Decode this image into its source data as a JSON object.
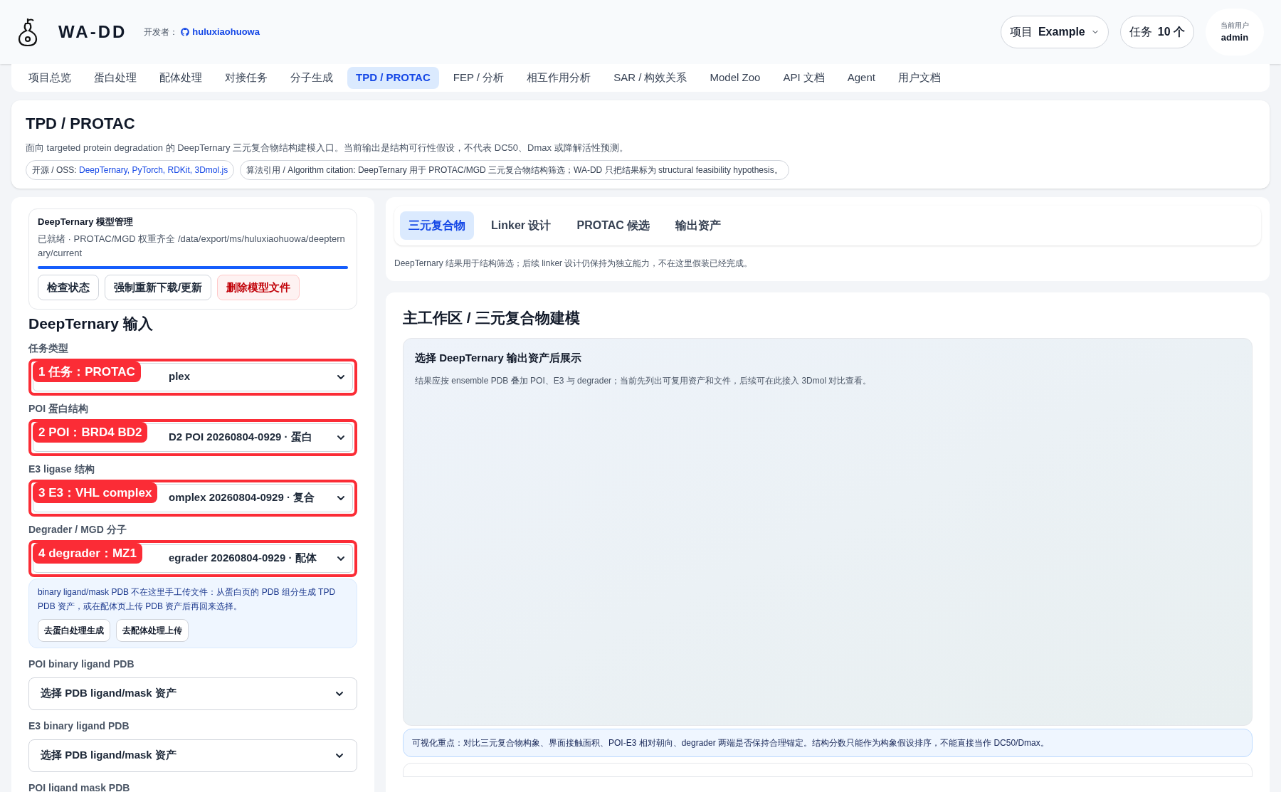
{
  "header": {
    "logo": "WA-DD",
    "developer_label": "开发者：",
    "developer": "huluxiaohuowa",
    "project_label": "项目",
    "project": "Example",
    "tasks_label": "任务",
    "tasks": "10 个",
    "user_label": "当前用户",
    "user": "admin"
  },
  "nav": [
    {
      "label": "项目总览",
      "selected": false
    },
    {
      "label": "蛋白处理",
      "selected": false
    },
    {
      "label": "配体处理",
      "selected": false
    },
    {
      "label": "对接任务",
      "selected": false
    },
    {
      "label": "分子生成",
      "selected": false
    },
    {
      "label": "TPD / PROTAC",
      "selected": true
    },
    {
      "label": "FEP / 分析",
      "selected": false
    },
    {
      "label": "相互作用分析",
      "selected": false
    },
    {
      "label": "SAR / 构效关系",
      "selected": false
    },
    {
      "label": "Model Zoo",
      "selected": false
    },
    {
      "label": "API 文档",
      "selected": false
    },
    {
      "label": "Agent",
      "selected": false
    },
    {
      "label": "用户文档",
      "selected": false
    }
  ],
  "page": {
    "title": "TPD / PROTAC",
    "subtitle": "面向 targeted protein degradation 的 DeepTernary 三元复合物结构建模入口。当前输出是结构可行性假设，不代表 DC50、Dmax 或降解活性预测。",
    "oss_label": "开源 / OSS:",
    "oss_links": "DeepTernary, PyTorch, RDKit, 3Dmol.js",
    "citation": "算法引用 / Algorithm citation: DeepTernary 用于 PROTAC/MGD 三元复合物结构筛选；WA-DD 只把结果标为 structural feasibility hypothesis。"
  },
  "model": {
    "title": "DeepTernary 模型管理",
    "status": "已就绪 · PROTAC/MGD 权重齐全 /data/export/ms/huluxiaohuowa/deepternary/current",
    "level": 1,
    "buttons": [
      {
        "label": "检查状态",
        "kind": "normal"
      },
      {
        "label": "强制重新下载/更新",
        "kind": "normal"
      },
      {
        "label": "删除模型文件",
        "kind": "danger"
      }
    ]
  },
  "inputs": {
    "title": "DeepTernary 输入",
    "fields": [
      {
        "label": "任务类型",
        "badge": "1 任务：PROTAC",
        "value": "plex"
      },
      {
        "label": "POI 蛋白结构",
        "badge": "2 POI：BRD4 BD2",
        "value": "D2 POI 20260804-0929 · 蛋白"
      },
      {
        "label": "E3 ligase 结构",
        "badge": "3 E3：VHL complex",
        "value": "omplex 20260804-0929 · 复合"
      },
      {
        "label": "Degrader / MGD 分子",
        "badge": "4 degrader：MZ1",
        "value": "egrader 20260804-0929 · 配体"
      }
    ],
    "notice": "binary ligand/mask PDB 不在这里手工传文件：从蛋白页的 PDB 组分生成 TPD PDB 资产，或在配体页上传 PDB 资产后再回来选择。",
    "notice_buttons": [
      "去蛋白处理生成",
      "去配体处理上传"
    ],
    "pdb_fields": [
      {
        "label": "POI binary ligand PDB",
        "value": "选择 PDB ligand/mask 资产"
      },
      {
        "label": "E3 binary ligand PDB",
        "value": "选择 PDB ligand/mask 资产"
      }
    ],
    "cut_label": "POI ligand mask PDB"
  },
  "tabs": [
    {
      "label": "三元复合物",
      "selected": true
    },
    {
      "label": "Linker 设计",
      "selected": false
    },
    {
      "label": "PROTAC 候选",
      "selected": false
    },
    {
      "label": "输出资产",
      "selected": false
    }
  ],
  "tabs_note": "DeepTernary 结果用于结构筛选；后续 linker 设计仍保持为独立能力，不在这里假装已经完成。",
  "workspace": {
    "title": "主工作区 / 三元复合物建模",
    "viewer_title": "选择 DeepTernary 输出资产后展示",
    "viewer_text": "结果应按 ensemble PDB 叠加 POI、E3 与 degrader；当前先列出可复用资产和文件，后续可在此接入 3Dmol 对比查看。",
    "focus": "可视化重点：对比三元复合物构象、界面接触面积、POI-E3 相对朝向、degrader 两端是否保持合理锚定。结构分数只能作为构象假设排序，不能直接当作 DC50/Dmax。"
  }
}
